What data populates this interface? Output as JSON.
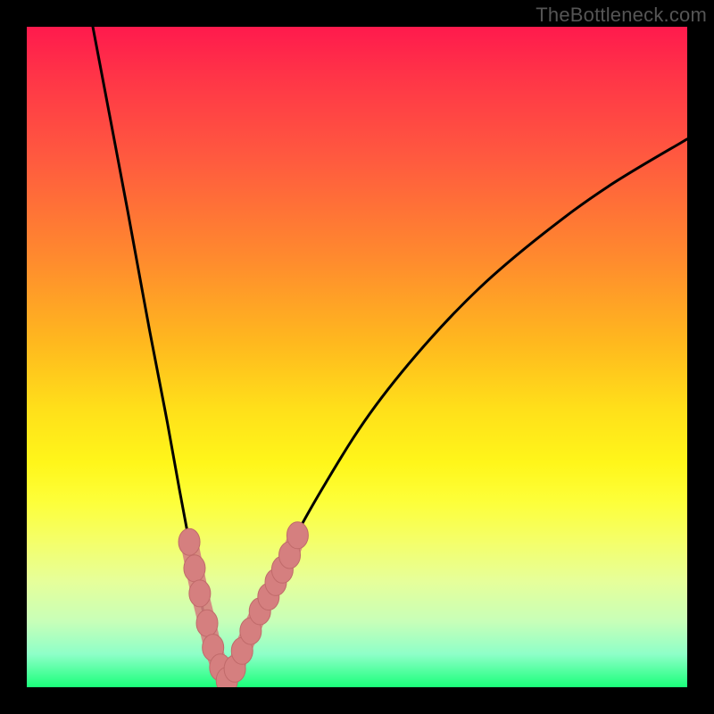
{
  "watermark": "TheBottleneck.com",
  "colors": {
    "frame": "#000000",
    "curve": "#000000",
    "marker_fill": "#d57f7f",
    "marker_stroke": "#c06a6a"
  },
  "chart_data": {
    "type": "line",
    "title": "",
    "xlabel": "",
    "ylabel": "",
    "xlim": [
      0,
      100
    ],
    "ylim": [
      0,
      100
    ],
    "note": "Decorative bottleneck curve with heatmap background; no numeric axes or tick labels are rendered in the image. x/y are normalized 0–100 with origin at bottom-left.",
    "series": [
      {
        "name": "left-branch",
        "x": [
          10.0,
          15.3,
          18.6,
          21.3,
          23.1,
          24.6,
          25.7,
          26.6,
          27.4,
          28.3,
          29.3,
          30.3
        ],
        "y": [
          100.0,
          72.0,
          54.0,
          40.0,
          30.0,
          22.0,
          16.0,
          12.0,
          8.5,
          5.5,
          3.0,
          1.0
        ]
      },
      {
        "name": "right-branch",
        "x": [
          30.3,
          31.6,
          33.6,
          36.6,
          40.0,
          45.3,
          52.0,
          60.0,
          68.6,
          78.0,
          88.0,
          100.0
        ],
        "y": [
          1.0,
          3.0,
          7.0,
          13.5,
          21.5,
          31.0,
          41.5,
          51.5,
          60.5,
          68.5,
          75.8,
          83.0
        ]
      }
    ],
    "markers": {
      "name": "highlighted-points",
      "x": [
        24.6,
        25.4,
        26.2,
        27.3,
        28.2,
        29.3,
        30.3,
        31.5,
        32.6,
        33.9,
        35.3,
        36.6,
        37.7,
        38.7,
        39.8,
        41.0
      ],
      "y": [
        22.0,
        18.0,
        14.2,
        9.7,
        6.0,
        3.0,
        1.0,
        2.8,
        5.5,
        8.5,
        11.5,
        13.7,
        15.9,
        17.8,
        20.0,
        23.0
      ]
    }
  }
}
